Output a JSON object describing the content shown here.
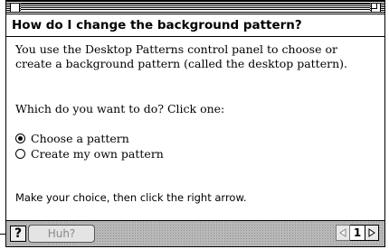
{
  "question": "How do I change the background pattern?",
  "body": {
    "paragraph1": "You use the Desktop Patterns control panel to choose or create a background pattern (called the desktop pattern).",
    "paragraph2": "Which do you want to do? Click one:",
    "options": [
      {
        "label": "Choose a pattern",
        "selected": true
      },
      {
        "label": "Create my own pattern",
        "selected": false
      }
    ],
    "note": "Make your choice, then click the right arrow."
  },
  "bottom_bar": {
    "help_label": "?",
    "huh_label": "Huh?",
    "page_number": "1",
    "prev_icon": "left-arrow-icon",
    "next_icon": "right-arrow-icon"
  }
}
